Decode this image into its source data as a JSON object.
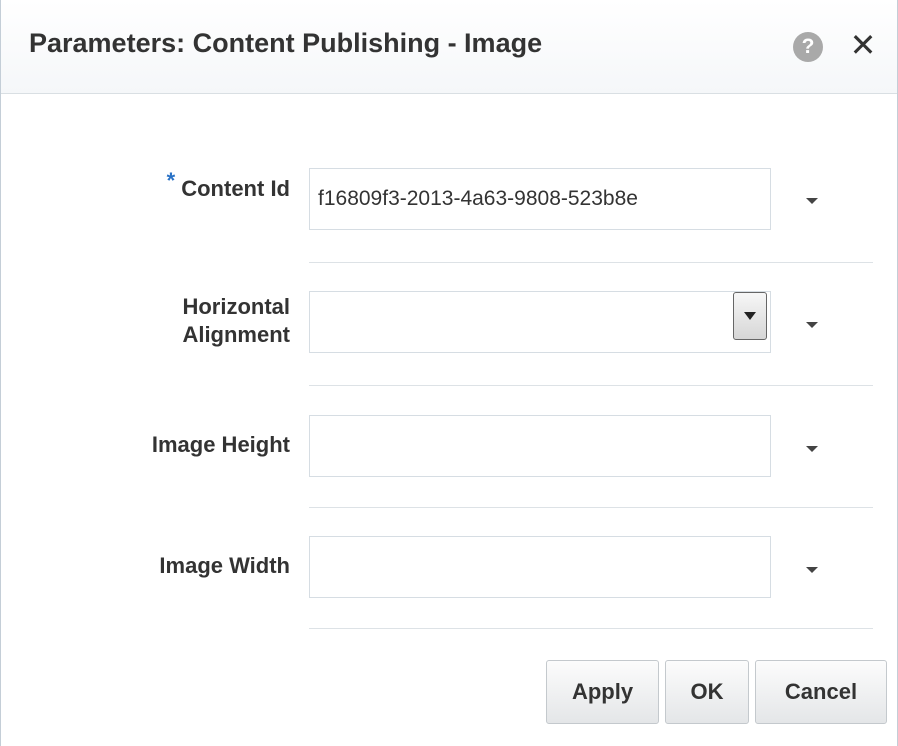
{
  "dialog": {
    "title": "Parameters: Content Publishing - Image",
    "help_icon": "question-circle-icon",
    "help_glyph": "?",
    "close_icon": "close-icon",
    "close_glyph": "✕"
  },
  "fields": {
    "content_id": {
      "required_marker": "*",
      "label": "Content Id",
      "value": "f16809f3-2013-4a63-9808-523b8e"
    },
    "horizontal_alignment": {
      "label_line1": "Horizontal",
      "label_line2": "Alignment",
      "value": ""
    },
    "image_height": {
      "label": "Image Height",
      "value": ""
    },
    "image_width": {
      "label": "Image Width",
      "value": ""
    }
  },
  "buttons": {
    "apply": "Apply",
    "ok": "OK",
    "cancel": "Cancel"
  },
  "colors": {
    "required_star": "#2a72c6",
    "help_icon_bg": "#a9a9a9"
  }
}
